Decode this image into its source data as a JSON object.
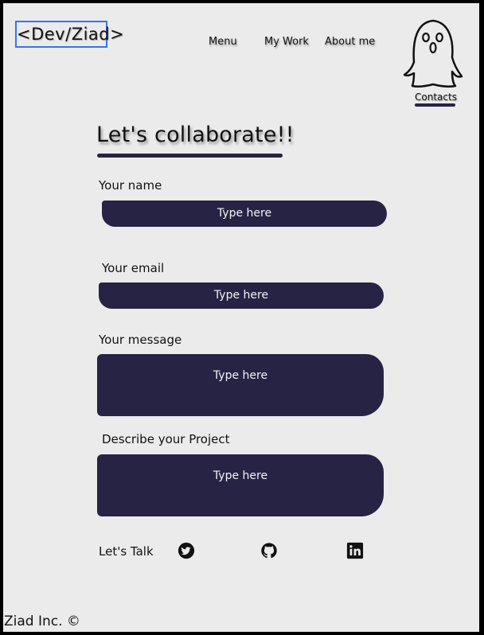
{
  "header": {
    "logo": "<Dev/Ziad>",
    "nav": [
      "Menu",
      "My Work",
      "About me"
    ],
    "contacts_label": "Contacts"
  },
  "main": {
    "title": "Let's collaborate!!",
    "fields": [
      {
        "label": "Your name",
        "placeholder": "Type here"
      },
      {
        "label": "Your email",
        "placeholder": "Type here"
      },
      {
        "label": "Your message",
        "placeholder": "Type here"
      },
      {
        "label": "Describe your Project",
        "placeholder": "Type here"
      }
    ],
    "lets_talk": "Let's Talk",
    "social_icons": [
      "twitter-icon",
      "github-icon",
      "linkedin-icon"
    ]
  },
  "footer": {
    "text": "Ziad Inc. ©"
  },
  "colors": {
    "field_bg": "#262345",
    "page_bg": "#ebebeb",
    "logo_border": "#3b73e8"
  }
}
